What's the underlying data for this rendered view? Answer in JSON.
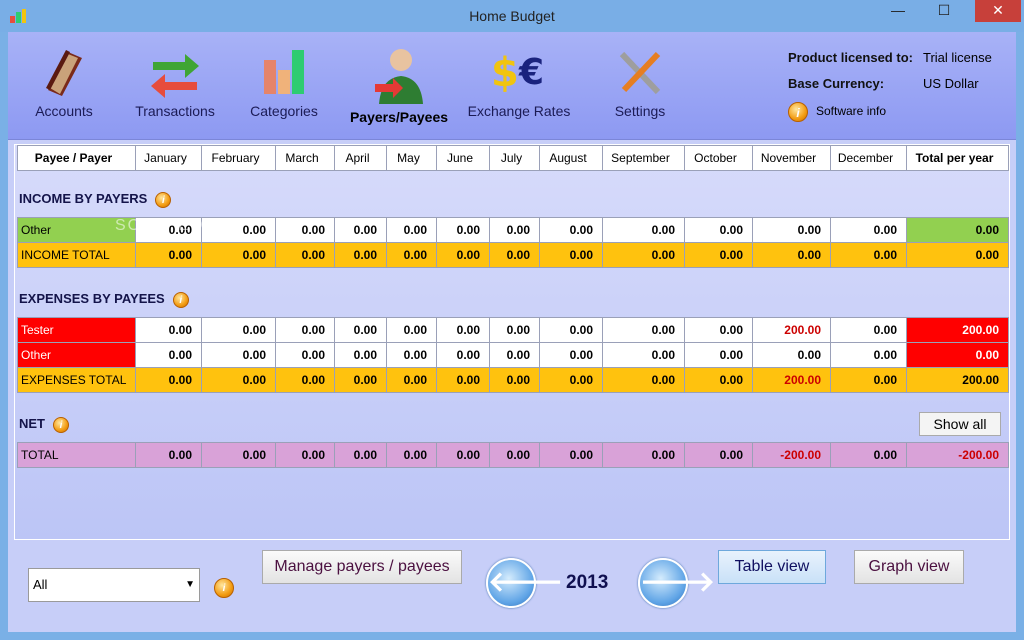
{
  "window": {
    "title": "Home Budget",
    "minimize": "—",
    "maximize": "☐",
    "close": "✕"
  },
  "toolbar": {
    "items": [
      {
        "label": "Accounts",
        "icon": "accounts-book-icon"
      },
      {
        "label": "Transactions",
        "icon": "transactions-arrows-icon"
      },
      {
        "label": "Categories",
        "icon": "categories-chart-icon"
      },
      {
        "label": "Payers/Payees",
        "icon": "payers-person-icon"
      },
      {
        "label": "Exchange Rates",
        "icon": "exchange-currency-icon"
      },
      {
        "label": "Settings",
        "icon": "settings-tools-icon"
      }
    ]
  },
  "license": {
    "product_label": "Product licensed to:",
    "product_value": "Trial license",
    "currency_label": "Base Currency:",
    "currency_value": "US Dollar",
    "software_info": "Software info"
  },
  "columns": [
    "Payee / Payer",
    "January",
    "February",
    "March",
    "April",
    "May",
    "June",
    "July",
    "August",
    "September",
    "October",
    "November",
    "December",
    "Total per year"
  ],
  "income": {
    "title": "INCOME BY PAYERS",
    "rows": [
      {
        "name": "Other",
        "values": [
          "0.00",
          "0.00",
          "0.00",
          "0.00",
          "0.00",
          "0.00",
          "0.00",
          "0.00",
          "0.00",
          "0.00",
          "0.00",
          "0.00",
          "0.00"
        ]
      },
      {
        "name": "INCOME TOTAL",
        "values": [
          "0.00",
          "0.00",
          "0.00",
          "0.00",
          "0.00",
          "0.00",
          "0.00",
          "0.00",
          "0.00",
          "0.00",
          "0.00",
          "0.00",
          "0.00"
        ]
      }
    ]
  },
  "expenses": {
    "title": "EXPENSES BY PAYEES",
    "rows": [
      {
        "name": "Tester",
        "values": [
          "0.00",
          "0.00",
          "0.00",
          "0.00",
          "0.00",
          "0.00",
          "0.00",
          "0.00",
          "0.00",
          "0.00",
          "200.00",
          "0.00",
          "200.00"
        ]
      },
      {
        "name": "Other",
        "values": [
          "0.00",
          "0.00",
          "0.00",
          "0.00",
          "0.00",
          "0.00",
          "0.00",
          "0.00",
          "0.00",
          "0.00",
          "0.00",
          "0.00",
          "0.00"
        ]
      },
      {
        "name": "EXPENSES TOTAL",
        "values": [
          "0.00",
          "0.00",
          "0.00",
          "0.00",
          "0.00",
          "0.00",
          "0.00",
          "0.00",
          "0.00",
          "0.00",
          "200.00",
          "0.00",
          "200.00"
        ]
      }
    ]
  },
  "net": {
    "title": "NET",
    "show_all": "Show all",
    "row": {
      "name": "TOTAL",
      "values": [
        "0.00",
        "0.00",
        "0.00",
        "0.00",
        "0.00",
        "0.00",
        "0.00",
        "0.00",
        "0.00",
        "0.00",
        "-200.00",
        "0.00",
        "-200.00"
      ]
    }
  },
  "watermark": "SOFTPEDIA",
  "bottom": {
    "filter_value": "All",
    "manage": "Manage payers / payees",
    "year": "2013",
    "table_view": "Table view",
    "graph_view": "Graph view"
  },
  "colors": {
    "accent_purple": "#8b005e",
    "red": "#ff0000",
    "yellow": "#ffc20e",
    "green": "#92d050",
    "pink": "#d9a2d8"
  }
}
